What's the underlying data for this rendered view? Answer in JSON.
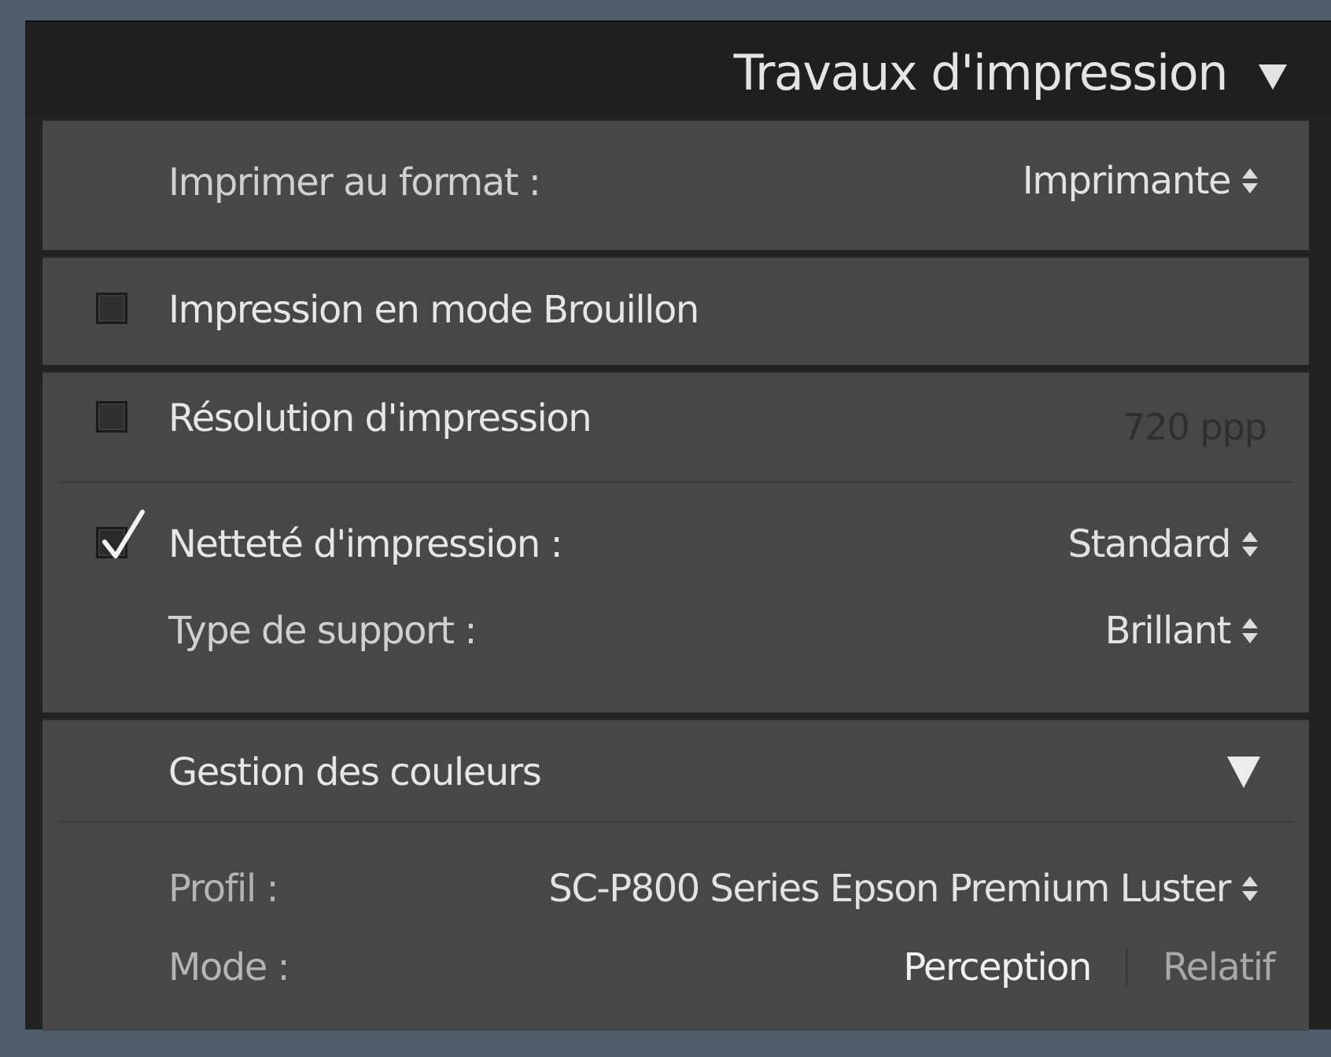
{
  "panel": {
    "title": "Travaux d'impression"
  },
  "format": {
    "label": "Imprimer au format :",
    "value": "Imprimante"
  },
  "draft": {
    "label": "Impression en mode Brouillon",
    "checked": false
  },
  "resolution": {
    "label": "Résolution d'impression",
    "checked": false,
    "value": "720  ppp"
  },
  "sharpening": {
    "label": "Netteté d'impression :",
    "checked": true,
    "value": "Standard"
  },
  "media": {
    "label": "Type de support :",
    "value": "Brillant"
  },
  "color_management": {
    "title": "Gestion des couleurs",
    "profile_label": "Profil :",
    "profile_value": "SC-P800 Series Epson Premium Luster",
    "mode_label": "Mode :",
    "mode_options": [
      "Perception",
      "Relatif"
    ],
    "mode_selected": "Perception"
  },
  "icons": {
    "collapse": "triangle-down-icon",
    "stepper": "up-down-chevron-icon",
    "checkmark": "checkmark-icon"
  }
}
